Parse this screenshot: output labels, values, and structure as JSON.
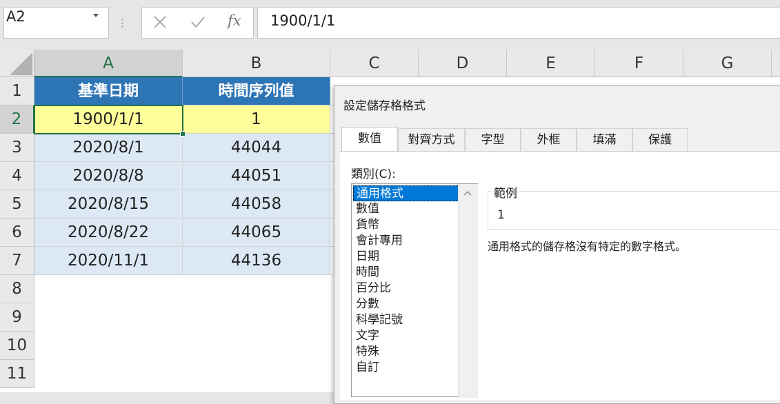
{
  "formula_bar": {
    "name_box": "A2",
    "formula": "1900/1/1",
    "fx_label": "fx"
  },
  "columns": [
    "A",
    "B",
    "C",
    "D",
    "E",
    "F",
    "G"
  ],
  "rows": [
    "1",
    "2",
    "3",
    "4",
    "5",
    "6",
    "7",
    "8",
    "9",
    "10",
    "11"
  ],
  "sheet": {
    "headers": [
      "基準日期",
      "時間序列值"
    ],
    "data": [
      [
        "1900/1/1",
        "1"
      ],
      [
        "2020/8/1",
        "44044"
      ],
      [
        "2020/8/8",
        "44051"
      ],
      [
        "2020/8/15",
        "44058"
      ],
      [
        "2020/8/22",
        "44065"
      ],
      [
        "2020/11/1",
        "44136"
      ]
    ]
  },
  "dialog": {
    "title": "設定儲存格格式",
    "tabs": [
      "數值",
      "對齊方式",
      "字型",
      "外框",
      "填滿",
      "保護"
    ],
    "active_tab": "數值",
    "category_label": "類別(C):",
    "categories": [
      "通用格式",
      "數值",
      "貨幣",
      "會計專用",
      "日期",
      "時間",
      "百分比",
      "分數",
      "科學記號",
      "文字",
      "特殊",
      "自訂"
    ],
    "selected_category": "通用格式",
    "sample_label": "範例",
    "sample_value": "1",
    "description": "通用格式的儲存格沒有特定的數字格式。"
  },
  "colors": {
    "header_fill": "#2e75b6",
    "highlight_fill": "#ffff9a",
    "data_fill": "#dce9f5",
    "selection_accent": "#217346",
    "list_selection": "#0078d7"
  }
}
